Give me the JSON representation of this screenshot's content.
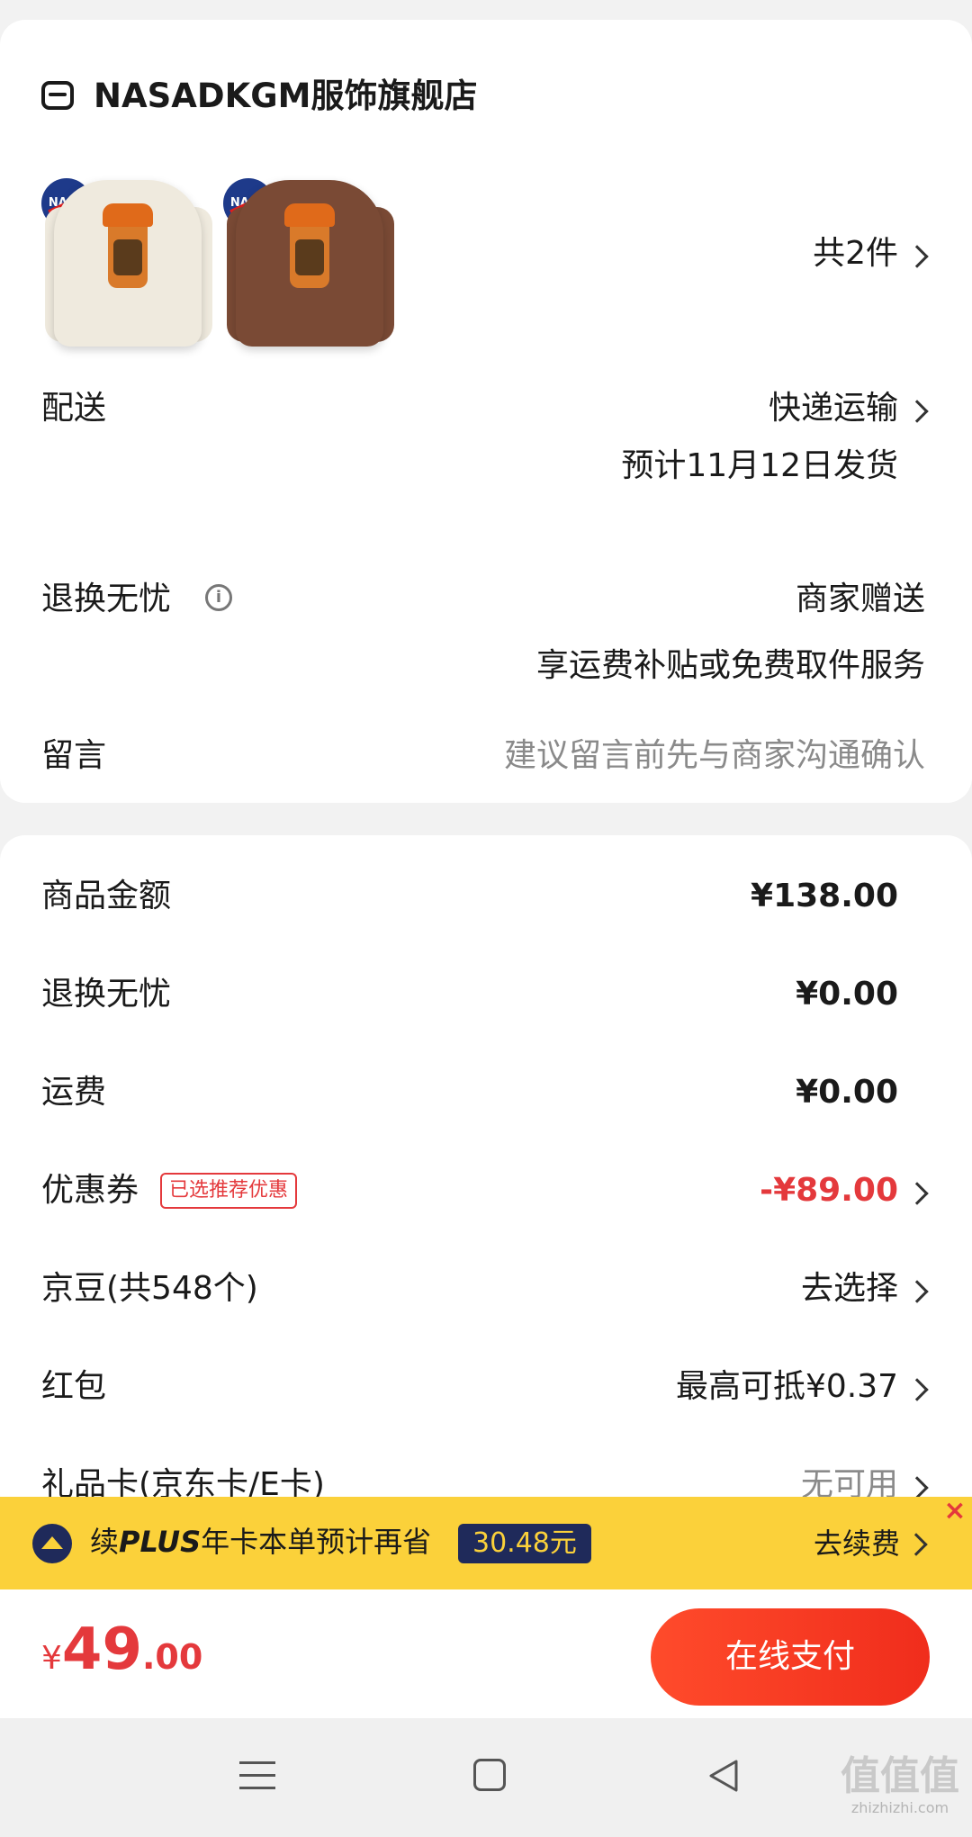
{
  "store": {
    "icon": "store-icon",
    "name": "NASADKGM服饰旗舰店"
  },
  "products": {
    "count_label": "共2件",
    "items": [
      {
        "color": "#efeade"
      },
      {
        "color": "#7a4a35"
      }
    ]
  },
  "delivery": {
    "label": "配送",
    "method": "快递运输",
    "estimate": "预计11月12日发货"
  },
  "return_worry": {
    "label": "退换无忧",
    "value": "商家赠送",
    "desc": "享运费补贴或免费取件服务"
  },
  "message": {
    "label": "留言",
    "placeholder": "建议留言前先与商家沟通确认"
  },
  "summary": {
    "goods_label": "商品金额",
    "goods_value": "¥138.00",
    "return_label": "退换无忧",
    "return_value": "¥0.00",
    "shipping_label": "运费",
    "shipping_value": "¥0.00",
    "coupon_label": "优惠券",
    "coupon_tag": "已选推荐优惠",
    "coupon_value": "-¥89.00",
    "beans_label": "京豆(共548个)",
    "beans_value": "去选择",
    "redpacket_label": "红包",
    "redpacket_value": "最高可抵¥0.37",
    "giftcard_label": "礼品卡(京东卡/E卡)",
    "giftcard_value": "无可用"
  },
  "plus_banner": {
    "text_prefix": "续",
    "plus": "PLUS",
    "text": "年卡本单预计再省",
    "amount": "30.48元",
    "action": "去续费",
    "close": "×"
  },
  "bottom": {
    "currency": "¥",
    "price_int": "49",
    "price_dec": ".00",
    "pay_button": "在线支付"
  },
  "colors": {
    "accent_red": "#e4393c",
    "pay_gradient_start": "#ff4b2b",
    "pay_gradient_end": "#f02d1c",
    "plus_yellow": "#fbd13a",
    "plus_navy": "#1f2a5a"
  },
  "watermark": {
    "text": "值值值",
    "domain": "zhizhizhi.com"
  }
}
